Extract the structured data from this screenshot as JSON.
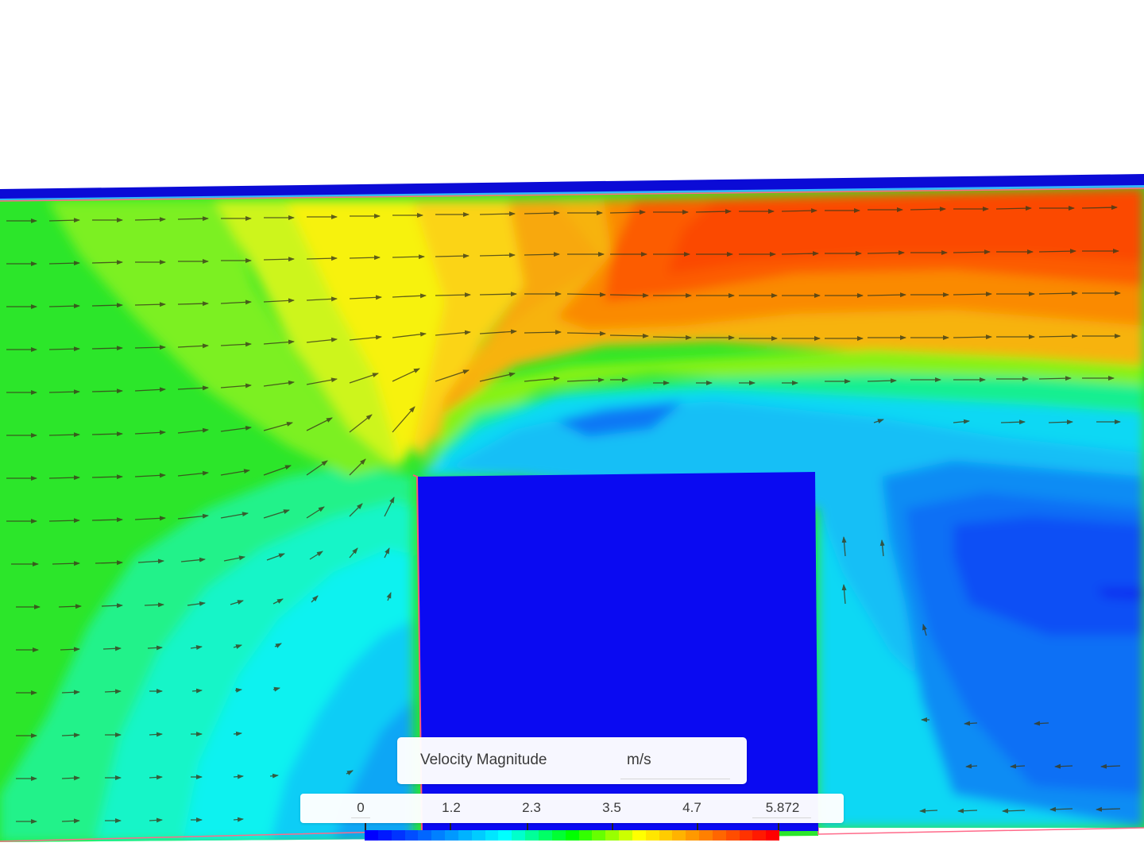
{
  "legend": {
    "title": "Velocity Magnitude",
    "unit": "m/s",
    "ticks": [
      "0",
      "1.2",
      "2.3",
      "3.5",
      "4.7",
      "5.872"
    ],
    "min": 0,
    "max": 5.872
  },
  "colormap": [
    "#0000ff",
    "#0019ff",
    "#0033ff",
    "#004dff",
    "#0066ff",
    "#0080ff",
    "#0099ff",
    "#00b3ff",
    "#00ccff",
    "#00e6ff",
    "#00ffff",
    "#00ffcc",
    "#00ff99",
    "#00ff66",
    "#00ff33",
    "#00ff00",
    "#33ff00",
    "#66ff00",
    "#99ff00",
    "#ccff00",
    "#ffff00",
    "#ffe600",
    "#ffcc00",
    "#ffb300",
    "#ff9900",
    "#ff8000",
    "#ff6600",
    "#ff4d00",
    "#ff3300",
    "#ff1a00",
    "#ff0000"
  ],
  "colors": {
    "obstacle": "#0a0af2",
    "wall": "#0b0bd6",
    "background": "#ffffff"
  }
}
